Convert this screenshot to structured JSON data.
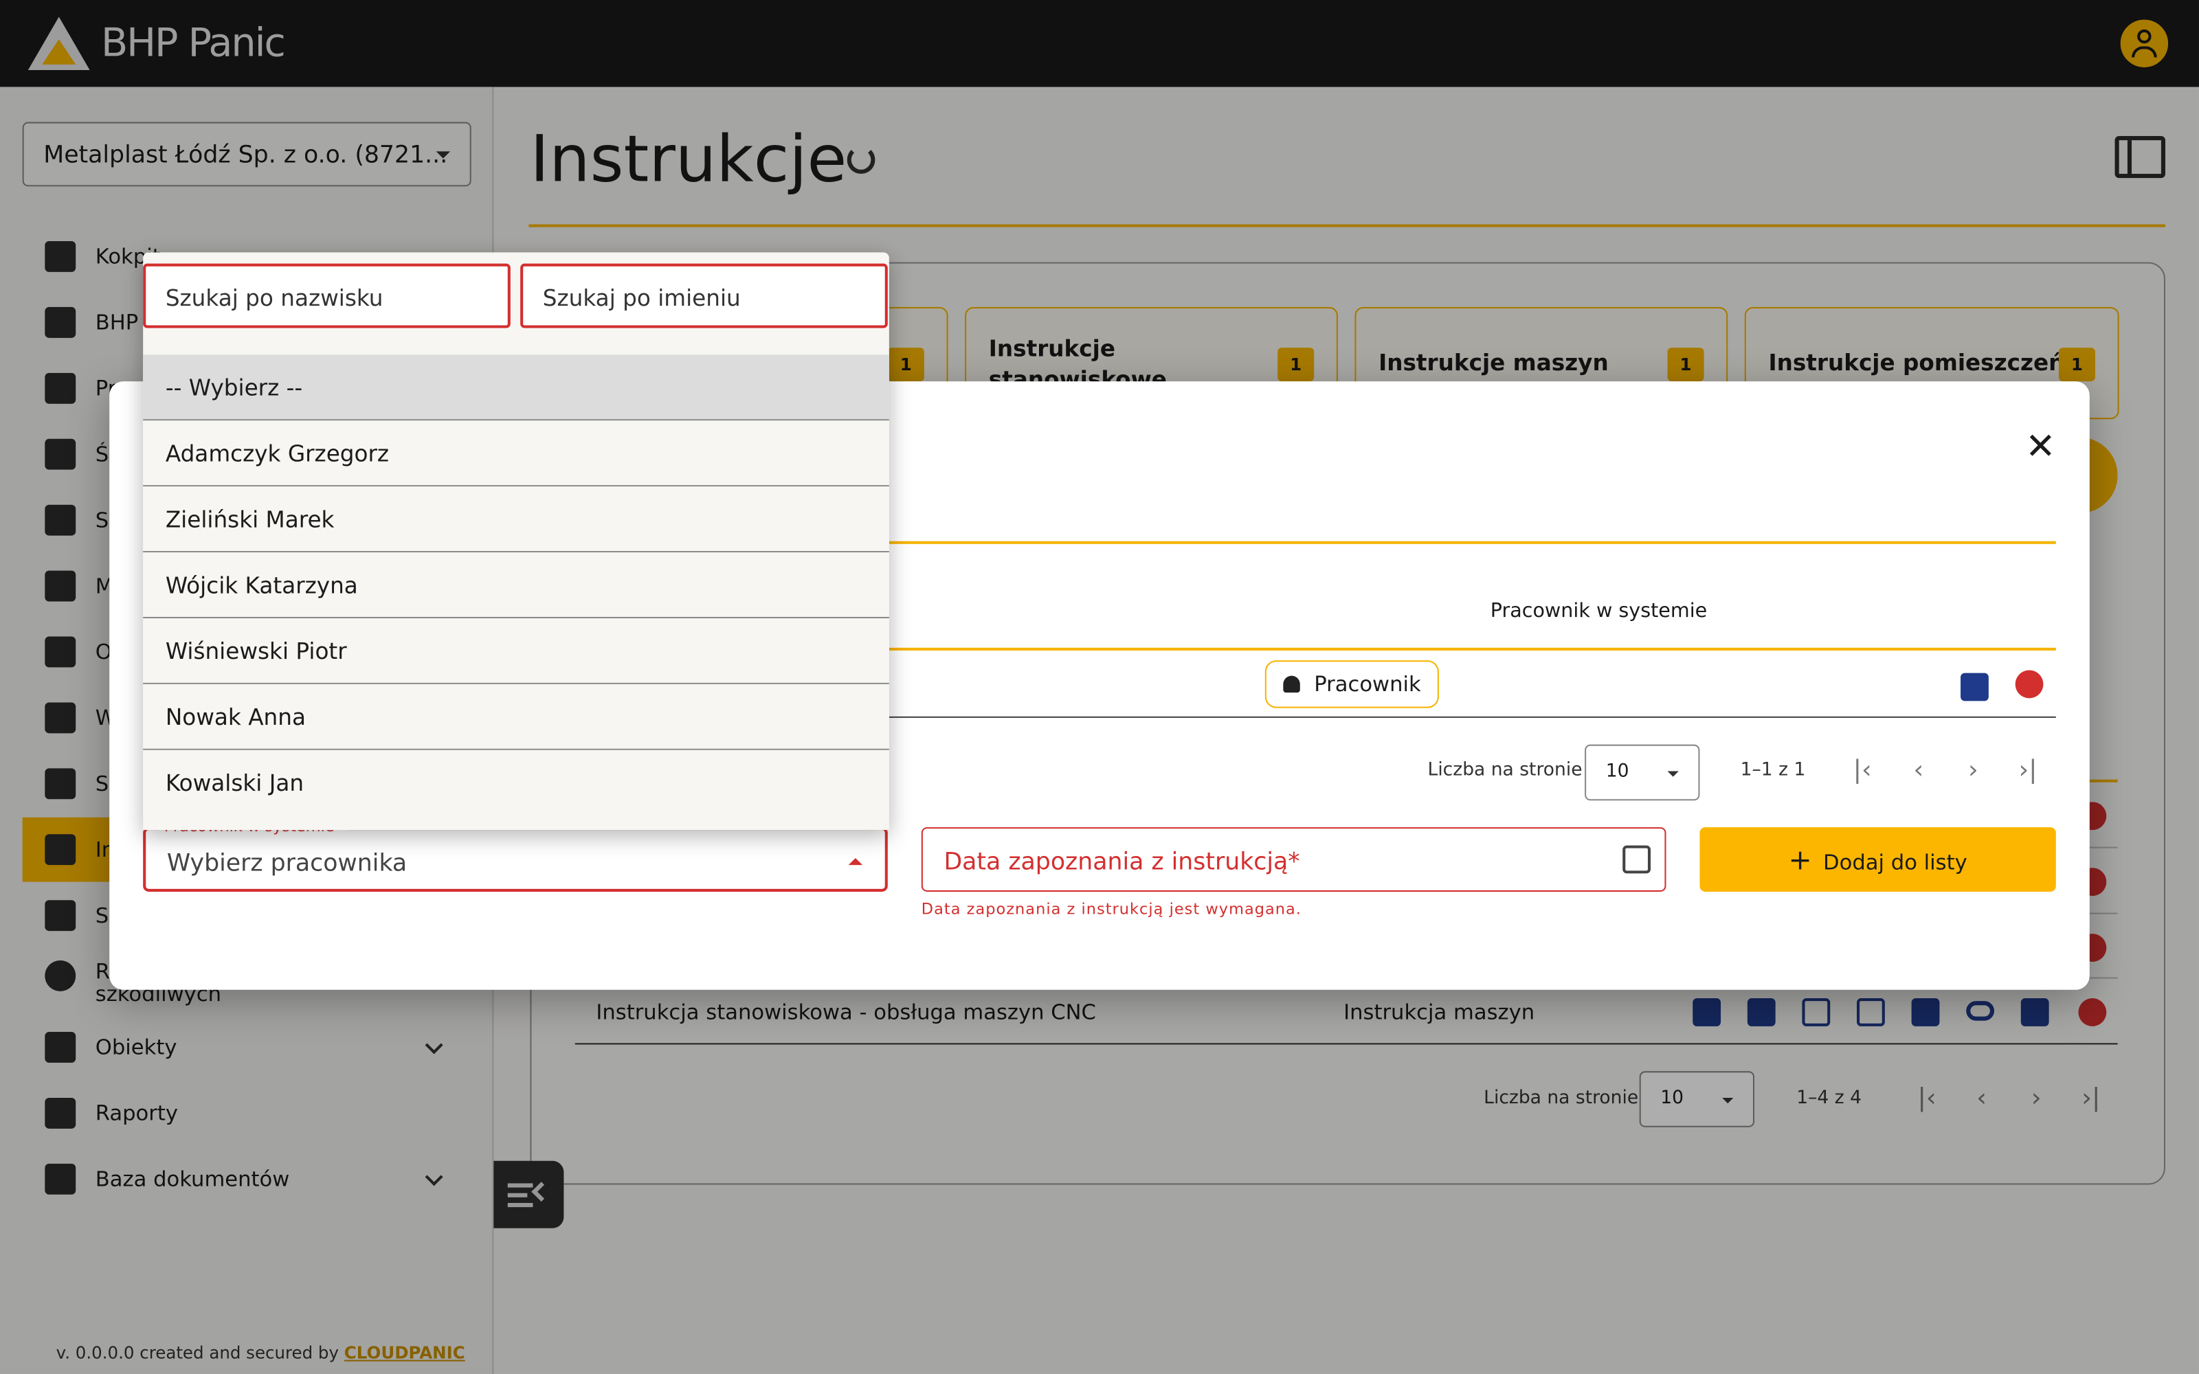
{
  "app": {
    "name": "BHP Panic"
  },
  "sidebar": {
    "company": "Metalplast Łódź Sp. z o.o. (8721...",
    "items": [
      {
        "label": "Kokpit"
      },
      {
        "label": "BHP N"
      },
      {
        "label": "Pr"
      },
      {
        "label": "Śr"
      },
      {
        "label": "Sz"
      },
      {
        "label": "M"
      },
      {
        "label": "O"
      },
      {
        "label": "W"
      },
      {
        "label": "Sy"
      },
      {
        "label": "In"
      },
      {
        "label": "Su"
      },
      {
        "label": "Ro",
        "label2": "szkodliwych"
      },
      {
        "label": "Obiekty"
      },
      {
        "label": "Raporty"
      },
      {
        "label": "Baza dokumentów"
      }
    ],
    "version_text": "v. 0.0.0.0 created and secured by",
    "version_brand": "CLOUDPANIC"
  },
  "main": {
    "title": "Instrukcje",
    "tiles": [
      {
        "label": "",
        "count": "1"
      },
      {
        "label": "Instrukcje stanowiskowe",
        "count": "1"
      },
      {
        "label": "Instrukcje maszyn",
        "count": "1"
      },
      {
        "label": "Instrukcje pomieszczeń",
        "count": "1"
      }
    ],
    "last_row": {
      "name": "Instrukcja stanowiskowa - obsługa maszyn CNC",
      "type": "Instrukcja maszyn"
    },
    "pager": {
      "label": "Liczba na stronie",
      "size": "10",
      "range": "1–4 z 4"
    }
  },
  "dialog": {
    "column_header": "Pracownik w systemie",
    "chip": "Pracownik",
    "pager": {
      "label": "Liczba na stronie",
      "size": "10",
      "range": "1–1 z 1"
    },
    "employee_label": "Pracownik w systemie*",
    "employee_value": "Wybierz pracownika",
    "date_label": "Data zapoznania z instrukcją*",
    "date_error": "Data zapoznania z instrukcją jest wymagana.",
    "add_button": "Dodaj do listy"
  },
  "dropdown": {
    "search_lastname": "Szukaj po nazwisku",
    "search_firstname": "Szukaj po imieniu",
    "options": [
      "-- Wybierz --",
      "Adamczyk Grzegorz",
      "Zieliński Marek",
      "Wójcik Katarzyna",
      "Wiśniewski Piotr",
      "Nowak Anna",
      "Kowalski Jan"
    ]
  },
  "colors": {
    "accent": "#f6b400",
    "error": "#d32f2f",
    "action": "#1f3a8a"
  }
}
